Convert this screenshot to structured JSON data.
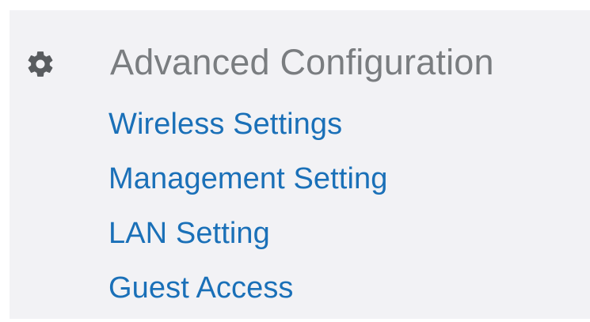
{
  "section": {
    "icon": "gear-icon",
    "title": "Advanced Configuration"
  },
  "nav": {
    "items": [
      {
        "label": "Wireless Settings"
      },
      {
        "label": "Management Setting"
      },
      {
        "label": "LAN Setting"
      },
      {
        "label": "Guest Access"
      }
    ]
  },
  "colors": {
    "panel_bg": "#f2f2f5",
    "title": "#7a7d80",
    "link": "#1a70b8",
    "icon": "#595c5f"
  }
}
